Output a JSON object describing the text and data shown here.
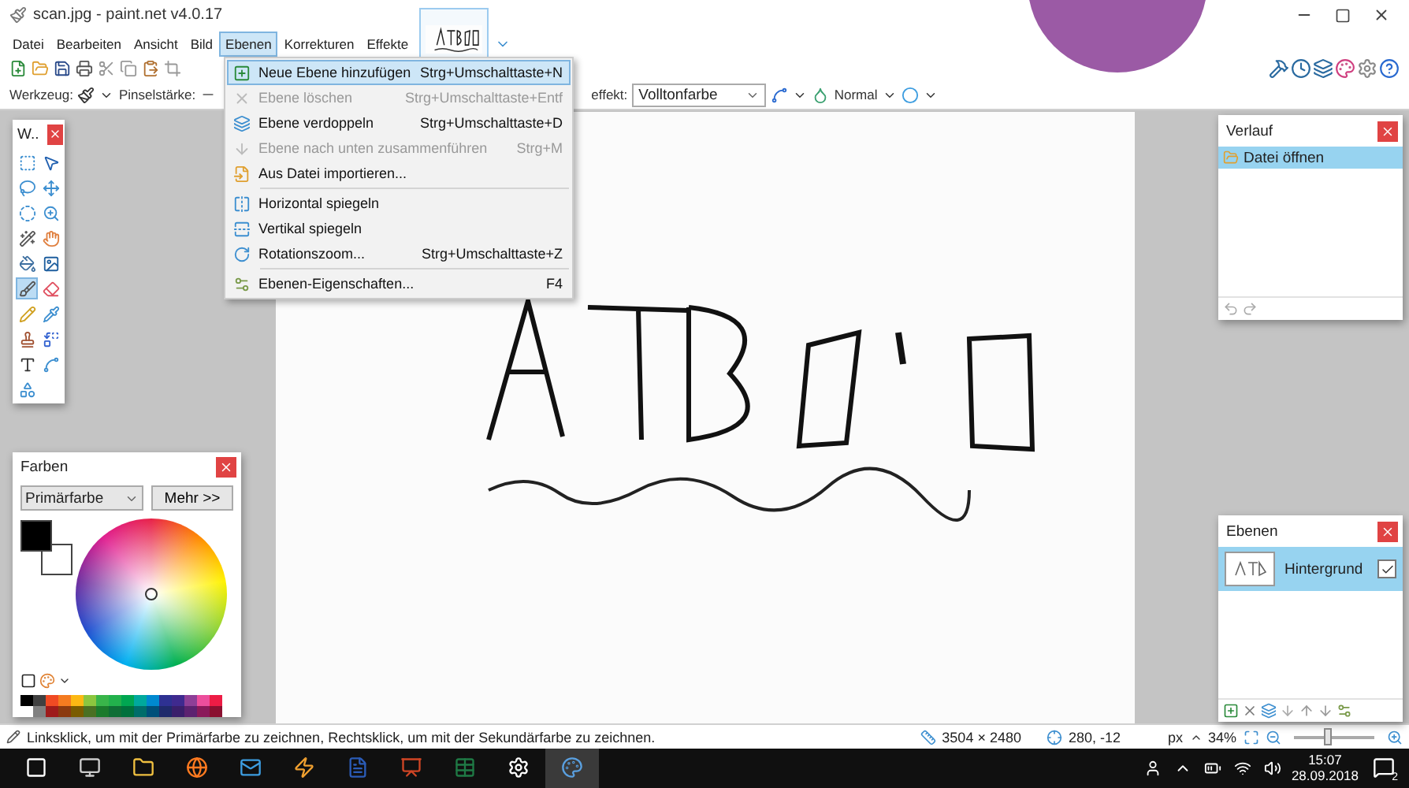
{
  "window": {
    "title": "scan.jpg - paint.net v4.0.17"
  },
  "menu": [
    {
      "label": "Datei",
      "selected": false
    },
    {
      "label": "Bearbeiten",
      "selected": false
    },
    {
      "label": "Ansicht",
      "selected": false
    },
    {
      "label": "Bild",
      "selected": false
    },
    {
      "label": "Ebenen",
      "selected": true
    },
    {
      "label": "Korrekturen",
      "selected": false
    },
    {
      "label": "Effekte",
      "selected": false
    }
  ],
  "layer_menu": [
    {
      "kind": "item",
      "label": "Neue Ebene hinzufügen",
      "shortcut": "Strg+Umschalttaste+N",
      "disabled": false,
      "selected": true
    },
    {
      "kind": "item",
      "label": "Ebene löschen",
      "shortcut": "Strg+Umschalttaste+Entf",
      "disabled": true,
      "selected": false
    },
    {
      "kind": "item",
      "label": "Ebene verdoppeln",
      "shortcut": "Strg+Umschalttaste+D",
      "disabled": false,
      "selected": false
    },
    {
      "kind": "item",
      "label": "Ebene nach unten zusammenführen",
      "shortcut": "Strg+M",
      "disabled": true,
      "selected": false
    },
    {
      "kind": "item",
      "label": "Aus Datei importieren...",
      "disabled": false,
      "selected": false
    },
    {
      "kind": "separator"
    },
    {
      "kind": "item",
      "label": "Horizontal spiegeln",
      "disabled": false,
      "selected": false
    },
    {
      "kind": "item",
      "label": "Vertikal spiegeln",
      "disabled": false,
      "selected": false
    },
    {
      "kind": "item",
      "label": "Rotationszoom...",
      "shortcut": "Strg+Umschalttaste+Z",
      "disabled": false,
      "selected": false
    },
    {
      "kind": "separator"
    },
    {
      "kind": "item",
      "label": "Ebenen-Eigenschaften...",
      "shortcut": "F4",
      "disabled": false,
      "selected": false
    }
  ],
  "tool_options": {
    "tool_label": "Werkzeug:",
    "brush_label": "Pinselstärke:",
    "effect_label": "effekt:",
    "effect_value": "Volltonfarbe",
    "blend_mode": "Normal"
  },
  "tools_window": {
    "title": "W..",
    "tools": [
      {
        "selected": false
      },
      {
        "selected": false
      },
      {
        "selected": false
      },
      {
        "selected": false
      },
      {
        "selected": false
      },
      {
        "selected": false
      },
      {
        "selected": false
      },
      {
        "selected": false
      },
      {
        "selected": false
      },
      {
        "selected": false
      },
      {
        "selected": true
      },
      {
        "selected": false
      },
      {
        "selected": false
      },
      {
        "selected": false
      },
      {
        "selected": false
      },
      {
        "selected": false
      },
      {
        "selected": false
      },
      {
        "selected": false
      },
      {
        "selected": false
      }
    ]
  },
  "colors_window": {
    "title": "Farben",
    "mode": "Primärfarbe",
    "more_button": "Mehr >>",
    "palette": [
      {
        "color": "#000000"
      },
      {
        "color": "#404040"
      },
      {
        "color": "#f04a23"
      },
      {
        "color": "#f47b20"
      },
      {
        "color": "#fcb813"
      },
      {
        "color": "#8cc63f"
      },
      {
        "color": "#39b54a"
      },
      {
        "color": "#22b14c"
      },
      {
        "color": "#00a651"
      },
      {
        "color": "#00a99d"
      },
      {
        "color": "#0089d0"
      },
      {
        "color": "#2e3192"
      },
      {
        "color": "#3f2a8f"
      },
      {
        "color": "#8e3f97"
      },
      {
        "color": "#ec4e9c"
      },
      {
        "color": "#ed1c45"
      },
      {
        "color": "#ffffff"
      },
      {
        "color": "#808080"
      },
      {
        "color": "#9e1b1b"
      },
      {
        "color": "#8b3a0f"
      },
      {
        "color": "#7a5c00"
      },
      {
        "color": "#4a7023"
      },
      {
        "color": "#1b7a2c"
      },
      {
        "color": "#0f6e35"
      },
      {
        "color": "#00703c"
      },
      {
        "color": "#006d6a"
      },
      {
        "color": "#00507a"
      },
      {
        "color": "#1f2a6b"
      },
      {
        "color": "#3a1f6b"
      },
      {
        "color": "#5c2270"
      },
      {
        "color": "#8a1a5a"
      },
      {
        "color": "#8a1030"
      }
    ]
  },
  "history_window": {
    "title": "Verlauf",
    "items": [
      {
        "label": "Datei öffnen",
        "selected": true
      }
    ]
  },
  "layers_window": {
    "title": "Ebenen",
    "layers": [
      {
        "name": "Hintergrund",
        "visible": true,
        "selected": true
      }
    ]
  },
  "status_bar": {
    "hint": "Linksklick, um mit der Primärfarbe zu zeichnen, Rechtsklick, um mit der Sekundärfarbe zu zeichnen.",
    "image_size": "3504 × 2480",
    "cursor": "280, -12",
    "unit": "px",
    "zoom": "34%",
    "zoom_slider": {
      "level": 0.42
    }
  },
  "taskbar": {
    "time": "15:07",
    "date": "28.09.2018",
    "notifications": "2"
  }
}
